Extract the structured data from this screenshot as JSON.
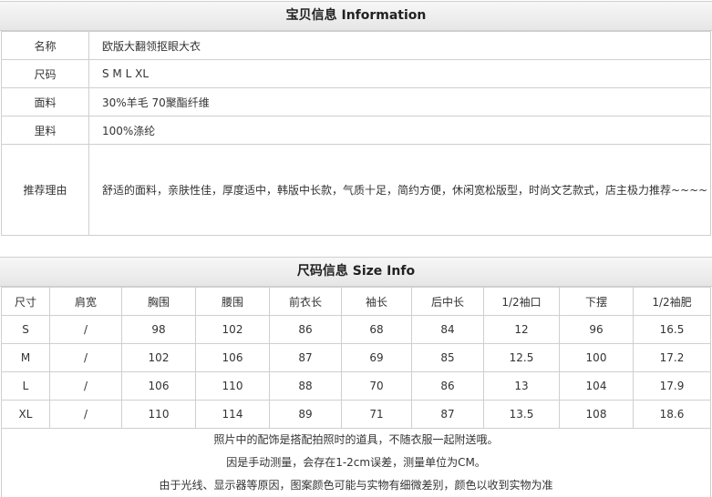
{
  "info": {
    "title": "宝贝信息 Information",
    "rows": [
      {
        "label": "名称",
        "value": "欧版大翻领抠眼大衣"
      },
      {
        "label": "尺码",
        "value": "S M L XL"
      },
      {
        "label": "面料",
        "value": "30%羊毛 70聚酯纤维"
      },
      {
        "label": "里料",
        "value": "100%涤纶"
      },
      {
        "label": "推荐理由",
        "value": "舒适的面料，亲肤性佳，厚度适中，韩版中长款，气质十足，简约方便，休闲宽松版型，时尚文艺款式，店主极力推荐~~~~"
      }
    ]
  },
  "size": {
    "title": "尺码信息 Size Info",
    "headers": [
      "尺寸",
      "肩宽",
      "胸围",
      "腰围",
      "前衣长",
      "袖长",
      "后中长",
      "1/2袖口",
      "下摆",
      "1/2袖肥"
    ],
    "rows": [
      [
        "S",
        "/",
        "98",
        "102",
        "86",
        "68",
        "84",
        "12",
        "96",
        "16.5"
      ],
      [
        "M",
        "/",
        "102",
        "106",
        "87",
        "69",
        "85",
        "12.5",
        "100",
        "17.2"
      ],
      [
        "L",
        "/",
        "106",
        "110",
        "88",
        "70",
        "86",
        "13",
        "104",
        "17.9"
      ],
      [
        "XL",
        "/",
        "110",
        "114",
        "89",
        "71",
        "87",
        "13.5",
        "108",
        "18.6"
      ]
    ]
  },
  "notes": [
    "照片中的配饰是搭配拍照时的道具，不随衣服一起附送哦。",
    "因是手动测量，会存在1-2cm误差，测量单位为CM。",
    "由于光线、显示器等原因，图案颜色可能与实物有细微差别，颜色以收到实物为准"
  ]
}
